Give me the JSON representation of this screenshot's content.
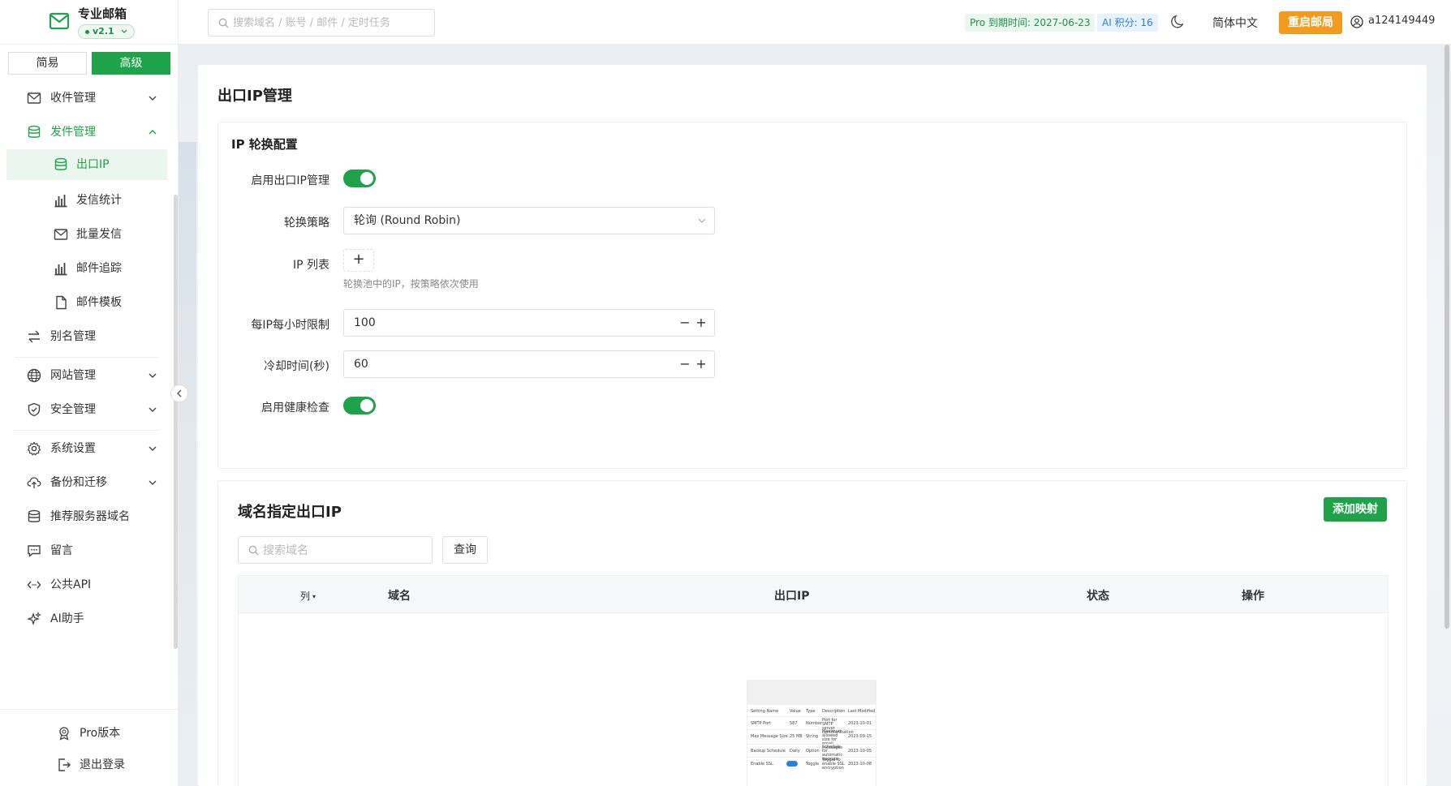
{
  "sidebar": {
    "brand_name": "专业邮箱",
    "version": "v2.1",
    "mode_simple": "简易",
    "mode_advanced": "高级",
    "items": [
      {
        "label": "收件管理"
      },
      {
        "label": "发件管理"
      },
      {
        "label": "出口IP"
      },
      {
        "label": "发信统计"
      },
      {
        "label": "批量发信"
      },
      {
        "label": "邮件追踪"
      },
      {
        "label": "邮件模板"
      },
      {
        "label": "别名管理"
      },
      {
        "label": "网站管理"
      },
      {
        "label": "安全管理"
      },
      {
        "label": "系统设置"
      },
      {
        "label": "备份和迁移"
      },
      {
        "label": "推荐服务器域名"
      },
      {
        "label": "留言"
      },
      {
        "label": "公共API"
      },
      {
        "label": "AI助手"
      }
    ],
    "bottom": {
      "pro": "Pro版本",
      "logout": "退出登录"
    }
  },
  "topbar": {
    "search_placeholder": "搜索域名 / 账号 / 邮件 / 定时任务",
    "pro_tag": "Pro 到期时间: 2027-06-23",
    "ai_tag": "AI 积分: 16",
    "language": "简体中文",
    "restart": "重启邮局",
    "username": "a124149449"
  },
  "page": {
    "title": "出口IP管理",
    "ip_config": {
      "title": "IP 轮换配置",
      "enable_label": "启用出口IP管理",
      "enable_on": true,
      "strategy_label": "轮换策略",
      "strategy_value": "轮询 (Round Robin)",
      "ip_list_label": "IP 列表",
      "ip_add": "+",
      "ip_hint": "轮换池中的IP，按策略依次使用",
      "limit_label": "每IP每小时限制",
      "limit_value": "100",
      "cooldown_label": "冷却时间(秒)",
      "cooldown_value": "60",
      "health_label": "启用健康检查",
      "health_on": true
    },
    "domain_ip": {
      "title": "域名指定出口IP",
      "add_button": "添加映射",
      "search_placeholder": "搜索域名",
      "query_button": "查询",
      "columns": {
        "col": "列",
        "domain": "域名",
        "ip": "出口IP",
        "status": "状态",
        "op": "操作"
      }
    }
  },
  "empty_illustration": {
    "headers": [
      "Setting Name",
      "Value",
      "Type",
      "Description",
      "Last Modified"
    ],
    "rows": [
      [
        "SMTP Port",
        "587",
        "Number",
        "Port for SMTP server communication",
        "2023-10-01"
      ],
      [
        "Max Message Size",
        "25 MB",
        "String",
        "Maximum allowed size for email messages",
        "2023-09-15"
      ],
      [
        "Backup Schedule",
        "Daily",
        "Option",
        "Schedule for automatic backups",
        "2023-10-05"
      ],
      [
        "Enable SSL",
        "",
        "Toggle",
        "Toggle to enable SSL encryption",
        "2023-10-08"
      ]
    ]
  },
  "colors": {
    "primary": "#1ea34a",
    "warning": "#f39a1f",
    "info": "#2f7fd6"
  }
}
